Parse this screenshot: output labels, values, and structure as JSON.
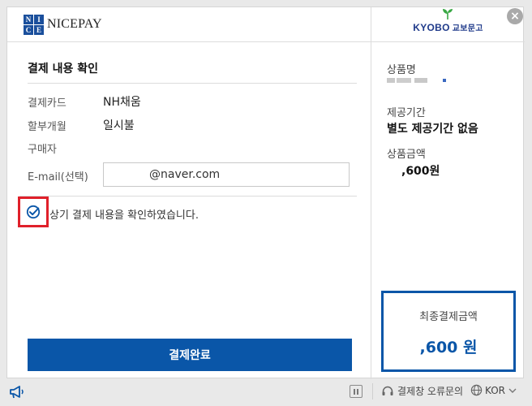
{
  "header": {
    "pg_logo_letters": [
      "N",
      "I",
      "C",
      "E"
    ],
    "pg_name": "NICEPAY",
    "merchant_brand": "KYOBO",
    "merchant_kr": "교보문고"
  },
  "close_label": "×",
  "main": {
    "title": "결제 내용 확인",
    "rows": [
      {
        "label": "결제카드",
        "value": "NH채움"
      },
      {
        "label": "할부개월",
        "value": "일시불"
      },
      {
        "label": "구매자",
        "value": ""
      }
    ],
    "email_label": "E-mail(선택)",
    "email_value": "@naver.com",
    "confirm_text": "상기 결제 내용을 확인하였습니다.",
    "confirm_checked": true,
    "pay_button": "결제완료"
  },
  "summary": {
    "product_label": "상품명",
    "period_label": "제공기간",
    "period_value": "별도 제공기간 없음",
    "price_label": "상품금액",
    "price_value": ",600원",
    "total_label": "최종결제금액",
    "total_value": ",600 원"
  },
  "footer": {
    "help_label": "결제창 오류문의",
    "lang_label": "KOR"
  },
  "colors": {
    "primary": "#0a56a8",
    "highlight": "#e0202a"
  }
}
